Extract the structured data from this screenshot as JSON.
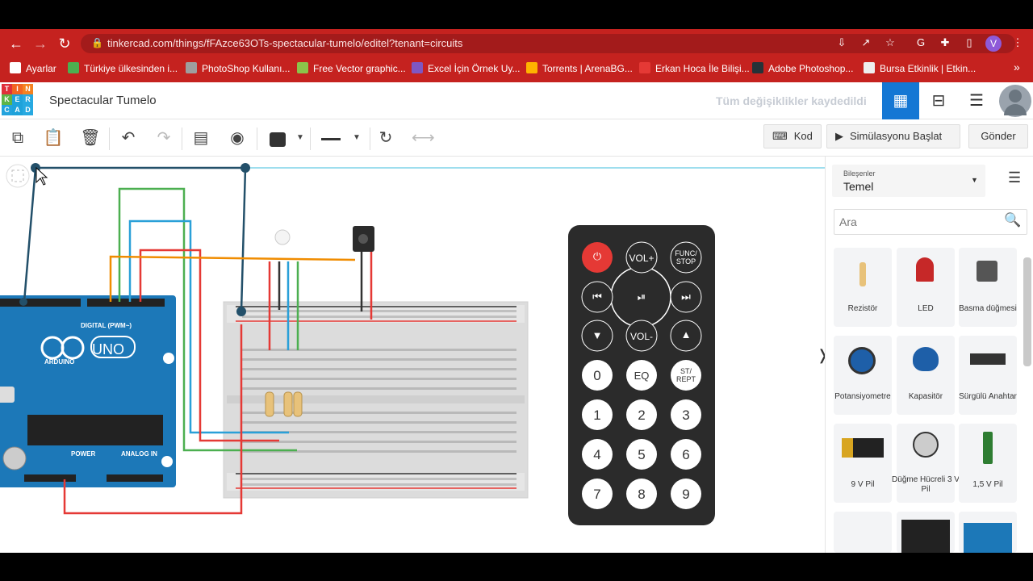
{
  "browser": {
    "url": "tinkercad.com/things/fFAzce63OTs-spectacular-tumelo/editel?tenant=circuits",
    "profile_initial": "V",
    "bookmarks": [
      {
        "label": "Ayarlar",
        "color": "#ffffff"
      },
      {
        "label": "Türkiye ülkesinden i...",
        "color": "#4caf50"
      },
      {
        "label": "PhotoShop Kullanı...",
        "color": "#9e9e9e"
      },
      {
        "label": "Free Vector graphic...",
        "color": "#8bc34a"
      },
      {
        "label": "Excel İçin Örnek Uy...",
        "color": "#7e57c2"
      },
      {
        "label": "Torrents | ArenaBG...",
        "color": "#ffb300"
      },
      {
        "label": "Erkan Hoca İle Bilişi...",
        "color": "#e53935"
      },
      {
        "label": "Adobe Photoshop...",
        "color": "#263238"
      },
      {
        "label": "Bursa Etkinlik | Etkin...",
        "color": "#eeeeee"
      }
    ],
    "more": "»"
  },
  "app": {
    "logo": [
      "TIN",
      "KER",
      "CAD"
    ],
    "project_title": "Spectacular Tumelo",
    "save_status": "Tüm değişiklikler kaydedildi",
    "toolbar": {
      "code_label": "Kod",
      "simulate_label": "Simülasyonu Başlat",
      "send_label": "Gönder"
    },
    "sidebar": {
      "components_caption": "Bileşenler",
      "components_value": "Temel",
      "search_placeholder": "Ara",
      "items": [
        {
          "label": "Rezistör"
        },
        {
          "label": "LED"
        },
        {
          "label": "Basma düğmesi"
        },
        {
          "label": "Potansiyometre"
        },
        {
          "label": "Kapasitör"
        },
        {
          "label": "Sürgülü Anahtar"
        },
        {
          "label": "9 V Pil"
        },
        {
          "label": "Düğme Hücreli 3 V Pil"
        },
        {
          "label": "1,5 V Pil"
        }
      ]
    },
    "arduino": {
      "brand": "UNO",
      "maker": "ARDUINO",
      "digital": "DIGITAL (PWM~)",
      "power": "POWER",
      "analog": "ANALOG IN"
    },
    "remote": {
      "buttons": [
        "VOL+",
        "FUNC/ STOP",
        "VOL-",
        "EQ",
        "ST/ REPT",
        "0",
        "1",
        "2",
        "3",
        "4",
        "5",
        "6",
        "7",
        "8",
        "9"
      ]
    },
    "colors": {
      "accent": "#1477d4",
      "chrome": "#c5221f",
      "arduino": "#1c78b8"
    }
  }
}
